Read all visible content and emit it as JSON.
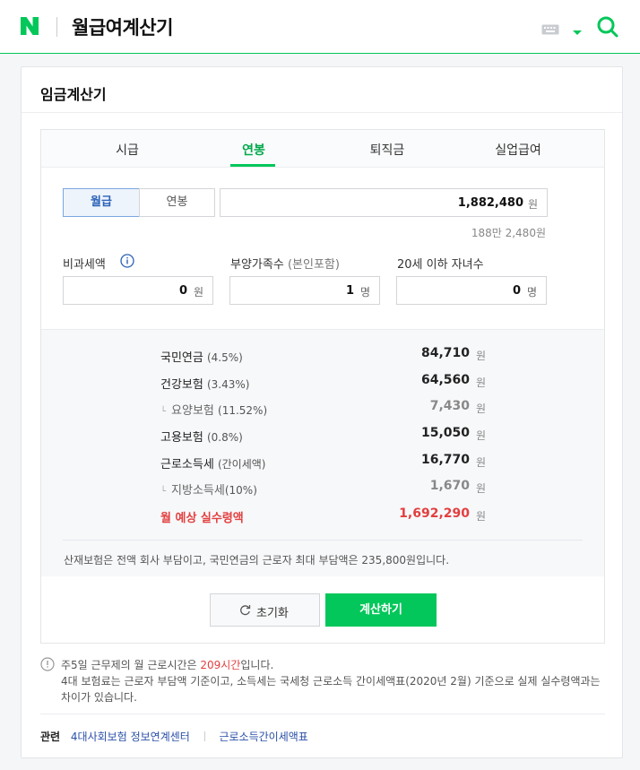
{
  "header": {
    "logo_letter": "N",
    "title": "월급여계산기",
    "brand_color": "#03c75a"
  },
  "card": {
    "title": "임금계산기"
  },
  "tabs": [
    {
      "label": "시급",
      "active": false
    },
    {
      "label": "연봉",
      "active": true
    },
    {
      "label": "퇴직금",
      "active": false
    },
    {
      "label": "실업급여",
      "active": false
    }
  ],
  "period": {
    "monthly_label": "월급",
    "annual_label": "연봉",
    "selected": "월급"
  },
  "amount": {
    "value": "1,882,480",
    "unit": "원",
    "hint": "188만 2,480원"
  },
  "fields": {
    "nontax": {
      "label": "비과세액",
      "value": "0",
      "unit": "원"
    },
    "dependents": {
      "label": "부양가족수",
      "sub": "(본인포함)",
      "value": "1",
      "unit": "명"
    },
    "children": {
      "label": "20세 이하 자녀수",
      "value": "0",
      "unit": "명"
    }
  },
  "results": [
    {
      "label": "국민연금",
      "pct": "(4.5%)",
      "value": "84,710",
      "unit": "원",
      "kind": "main"
    },
    {
      "label": "건강보험",
      "pct": "(3.43%)",
      "value": "64,560",
      "unit": "원",
      "kind": "main"
    },
    {
      "label": "요양보험",
      "pct": "(11.52%)",
      "value": "7,430",
      "unit": "원",
      "kind": "sub"
    },
    {
      "label": "고용보험",
      "pct": "(0.8%)",
      "value": "15,050",
      "unit": "원",
      "kind": "main"
    },
    {
      "label": "근로소득세",
      "pct": "(간이세액)",
      "value": "16,770",
      "unit": "원",
      "kind": "main"
    },
    {
      "label": "지방소득세",
      "pct": "(10%)",
      "value": "1,670",
      "unit": "원",
      "kind": "sub"
    },
    {
      "label": "월 예상 실수령액",
      "pct": "",
      "value": "1,692,290",
      "unit": "원",
      "kind": "total"
    }
  ],
  "result_note": "산재보험은 전액 회사 부담이고, 국민연금의 근로자 최대 부담액은 235,800원입니다.",
  "buttons": {
    "reset": "초기화",
    "calculate": "계산하기"
  },
  "notice": {
    "line1_pre": "주5일 근무제의 월 근로시간은 ",
    "line1_hl": "209시간",
    "line1_post": "입니다.",
    "line2": "4대 보험료는 근로자 부담액 기준이고, 소득세는 국세청 근로소득 간이세액표(2020년 2월) 기준으로 실제 실수령액과는 차이가 있습니다."
  },
  "related": {
    "label": "관련",
    "links": [
      "4대사회보험 정보연계센터",
      "근로소득간이세액표"
    ]
  }
}
